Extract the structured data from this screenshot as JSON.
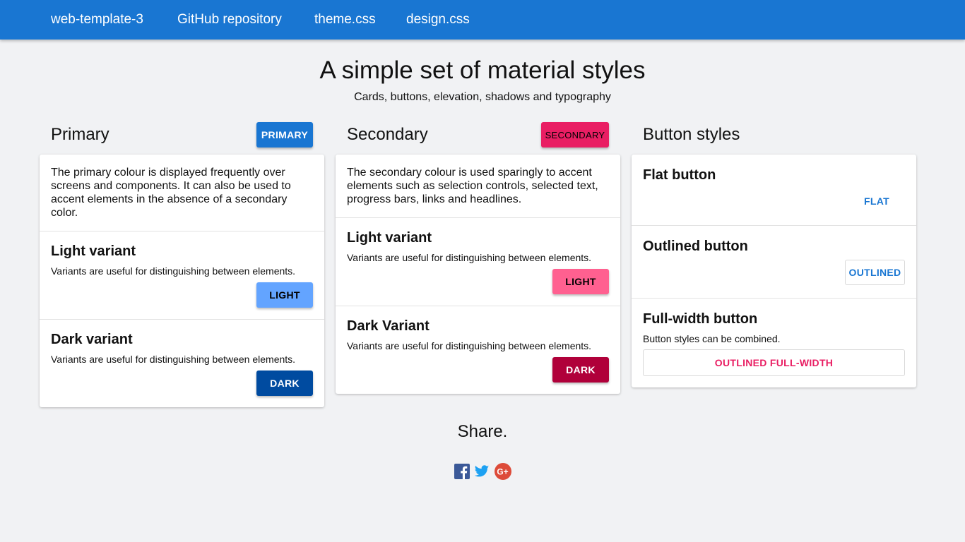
{
  "nav": {
    "links": [
      "web-template-3",
      "GitHub repository",
      "theme.css",
      "design.css"
    ]
  },
  "hero": {
    "title": "A simple set of material styles",
    "subtitle": "Cards, buttons, elevation, shadows and typography"
  },
  "primary": {
    "title": "Primary",
    "button": "PRIMARY",
    "intro": "The primary colour is displayed frequently over screens and components. It can also be used to accent elements in the absence of a secondary color.",
    "light": {
      "title": "Light variant",
      "text": "Variants are useful for distinguishing between elements.",
      "button": "LIGHT"
    },
    "dark": {
      "title": "Dark variant",
      "text": "Variants are useful for distinguishing between elements.",
      "button": "DARK"
    }
  },
  "secondary": {
    "title": "Secondary",
    "button": "SECONDARY",
    "intro": "The secondary colour is used sparingly to accent elements such as selection controls, selected text, progress bars, links and headlines.",
    "light": {
      "title": "Light variant",
      "text": "Variants are useful for distinguishing between elements.",
      "button": "LIGHT"
    },
    "dark": {
      "title": "Dark Variant",
      "text": "Variants are useful for distinguishing between elements.",
      "button": "DARK"
    }
  },
  "button_styles": {
    "title": "Button styles",
    "flat": {
      "title": "Flat button",
      "button": "FLAT"
    },
    "outlined": {
      "title": "Outlined button",
      "button": "OUTLINED"
    },
    "fullwidth": {
      "title": "Full-width button",
      "text": "Button styles can be combined.",
      "button": "OUTLINED FULL-WIDTH"
    }
  },
  "share": {
    "title": "Share.",
    "icons": [
      "facebook-icon",
      "twitter-icon",
      "google-plus-icon"
    ]
  },
  "colors": {
    "primary": "#1976d2",
    "primary_light": "#63a4ff",
    "primary_dark": "#004ba0",
    "secondary": "#e91e63",
    "secondary_light": "#ff6090",
    "secondary_dark": "#b0003a",
    "background": "#f1f2f4"
  }
}
